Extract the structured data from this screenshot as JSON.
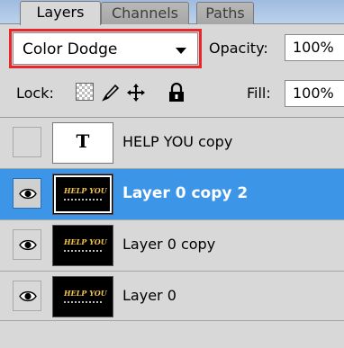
{
  "tabs": [
    {
      "label": "Layers",
      "active": true
    },
    {
      "label": "Channels",
      "active": false
    },
    {
      "label": "Paths",
      "active": false
    }
  ],
  "blend_mode": {
    "value": "Color Dodge"
  },
  "opacity": {
    "label": "Opacity:",
    "value": "100%"
  },
  "lock": {
    "label": "Lock:",
    "icons": [
      "lock-transparent-pixels-icon",
      "lock-image-pixels-icon",
      "lock-position-icon",
      "lock-all-icon"
    ]
  },
  "fill": {
    "label": "Fill:",
    "value": "100%"
  },
  "layers": [
    {
      "name": "HELP YOU copy",
      "visible": false,
      "type": "text",
      "thumb_glyph": "T",
      "selected": false
    },
    {
      "name": "Layer 0 copy 2",
      "visible": true,
      "type": "image",
      "thumb_text": "HELP YOU",
      "selected": true
    },
    {
      "name": "Layer 0 copy",
      "visible": true,
      "type": "image",
      "thumb_text": "HELP YOU",
      "selected": false
    },
    {
      "name": "Layer 0",
      "visible": true,
      "type": "image",
      "thumb_text": "HELP YOU",
      "selected": false
    }
  ],
  "colors": {
    "selection": "#3d95e8",
    "highlight_box": "#e8262b",
    "thumbnail_text": "#f2c34a"
  }
}
